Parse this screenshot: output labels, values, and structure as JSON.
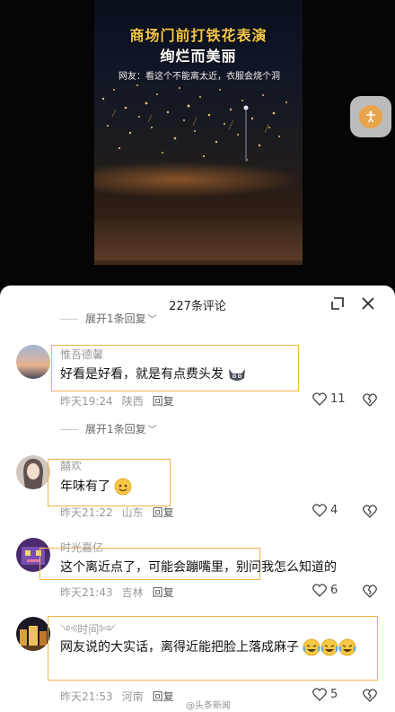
{
  "video": {
    "title_line1": "商场门前打铁花表演",
    "title_line2": "绚烂而美丽",
    "caption": "网友：看这个不能离太近，衣服会烧个洞"
  },
  "sheet": {
    "title": "227条评论"
  },
  "reply_toggle_top": "展开1条回复",
  "comments": [
    {
      "username": "惟吾德馨",
      "text": "好看是好看，就是有点费头发",
      "time": "昨天19:24",
      "location": "陕西",
      "reply": "回复",
      "likes": "11",
      "expand_replies": "展开1条回复"
    },
    {
      "username": "囍欢",
      "text": "年味有了",
      "time": "昨天21:22",
      "location": "山东",
      "reply": "回复",
      "likes": "4"
    },
    {
      "username": "时光嘉亿",
      "text": "这个离近点了，可能会蹦嘴里，别问我怎么知道的",
      "time": "昨天21:43",
      "location": "吉林",
      "reply": "回复",
      "likes": "6"
    },
    {
      "username": "༺时间༻",
      "text": "网友说的大实话，离得近能把脸上落成麻子",
      "time": "昨天21:53",
      "location": "河南",
      "reply": "回复",
      "likes": "5"
    }
  ],
  "watermark": "@头条新闻",
  "icons": {
    "expand": "expand-icon",
    "close": "close-icon",
    "like": "heart-icon",
    "dislike": "broken-heart-icon",
    "chevron": "chevron-down-icon"
  },
  "colors": {
    "highlight": "#f2b347",
    "title_gold": "#f6c84a"
  }
}
